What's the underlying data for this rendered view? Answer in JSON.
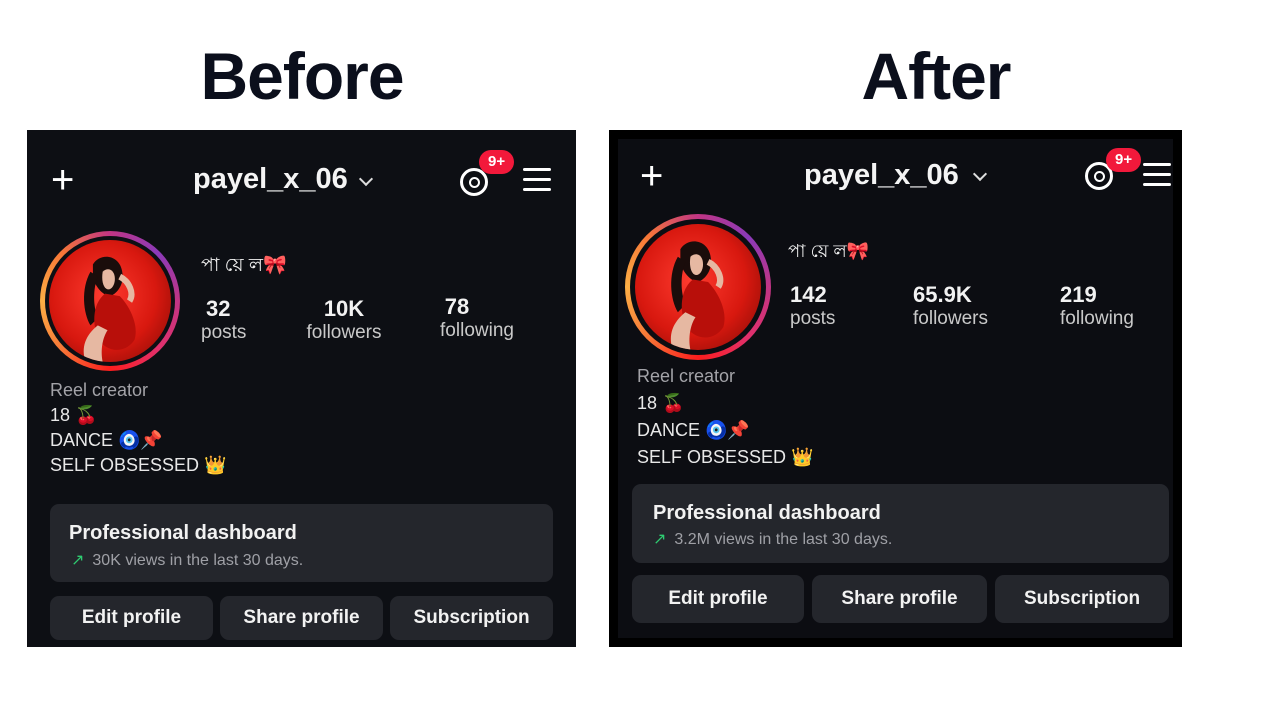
{
  "headings": {
    "before": "Before",
    "after": "After"
  },
  "before": {
    "username": "payel_x_06",
    "notification_badge": "9+",
    "display_name": "পা য়ে ল🎀",
    "stats": [
      {
        "value": "32",
        "label": "posts"
      },
      {
        "value": "10K",
        "label": "followers"
      },
      {
        "value": "78",
        "label": "following"
      }
    ],
    "bio": [
      "Reel creator",
      "18 🍒",
      "DANCE 🧿📌",
      "SELF OBSESSED 👑"
    ],
    "dashboard": {
      "title": "Professional dashboard",
      "subtitle": "30K views in the last 30 days."
    },
    "buttons": [
      "Edit profile",
      "Share profile",
      "Subscription"
    ]
  },
  "after": {
    "username": "payel_x_06",
    "notification_badge": "9+",
    "display_name": "পা য়ে ল🎀",
    "stats": [
      {
        "value": "142",
        "label": "posts"
      },
      {
        "value": "65.9K",
        "label": "followers"
      },
      {
        "value": "219",
        "label": "following"
      }
    ],
    "bio": [
      "Reel creator",
      "18 🍒",
      "DANCE 🧿📌",
      "SELF OBSESSED 👑"
    ],
    "dashboard": {
      "title": "Professional dashboard",
      "subtitle": "3.2M views in the last 30 days."
    },
    "buttons": [
      "Edit profile",
      "Share profile",
      "Subscription"
    ]
  },
  "icons": {
    "plus": "plus-icon",
    "chevron": "chevron-down-icon",
    "threads": "threads-icon",
    "menu": "menu-icon",
    "trend": "trend-up-arrow-icon"
  },
  "colors": {
    "badge": "#f2193b",
    "trend": "#2ecc71",
    "card": "#24262c",
    "background": "#0d0f14"
  }
}
